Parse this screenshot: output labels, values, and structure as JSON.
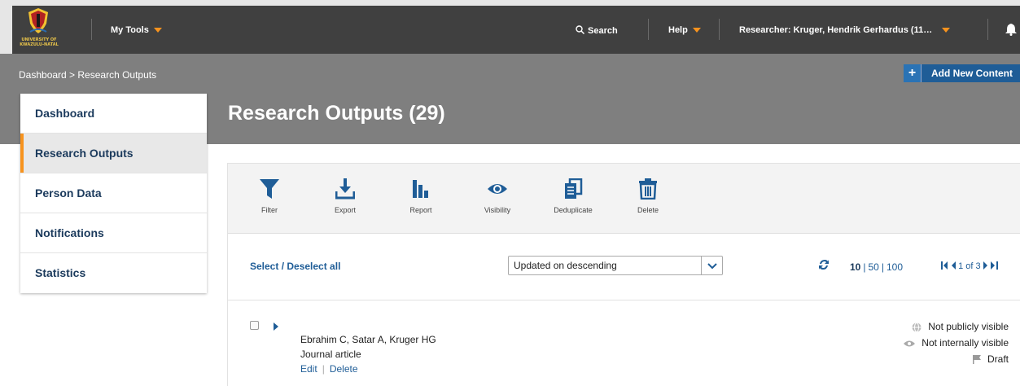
{
  "brand": {
    "logo_text": "UNIVERSITY OF KWAZULU-NATAL",
    "colors": {
      "accent": "#f7931e",
      "primary": "#1f5d97",
      "topbar": "#404040",
      "band": "#7f7f7f"
    }
  },
  "topnav": {
    "my_tools": "My Tools",
    "search": "Search",
    "help": "Help",
    "researcher": "Researcher: Kruger, Hendrik Gerhardus (11…",
    "bell_icon": "bell-icon"
  },
  "header": {
    "breadcrumb": "Dashboard > Research Outputs",
    "add_button": "Add New Content",
    "add_icon": "+",
    "title": "Research Outputs (29)"
  },
  "sidebar": {
    "items": [
      {
        "label": "Dashboard",
        "active": false
      },
      {
        "label": "Research Outputs",
        "active": true
      },
      {
        "label": "Person Data",
        "active": false
      },
      {
        "label": "Notifications",
        "active": false
      },
      {
        "label": "Statistics",
        "active": false
      }
    ]
  },
  "toolbar": {
    "filter": "Filter",
    "export": "Export",
    "report": "Report",
    "visibility": "Visibility",
    "deduplicate": "Deduplicate",
    "delete": "Delete"
  },
  "listing": {
    "select_all": "Select / Deselect all",
    "sort_value": "Updated on descending",
    "page_sizes": [
      "10",
      "50",
      "100"
    ],
    "page_sep": "|",
    "pager": "1 of 3"
  },
  "results": [
    {
      "authors": "Ebrahim C, Satar A, Kruger HG",
      "type": "Journal article",
      "edit": "Edit",
      "delete": "Delete",
      "action_sep": "|",
      "public": "Not publicly visible",
      "internal": "Not internally visible",
      "status": "Draft"
    }
  ]
}
